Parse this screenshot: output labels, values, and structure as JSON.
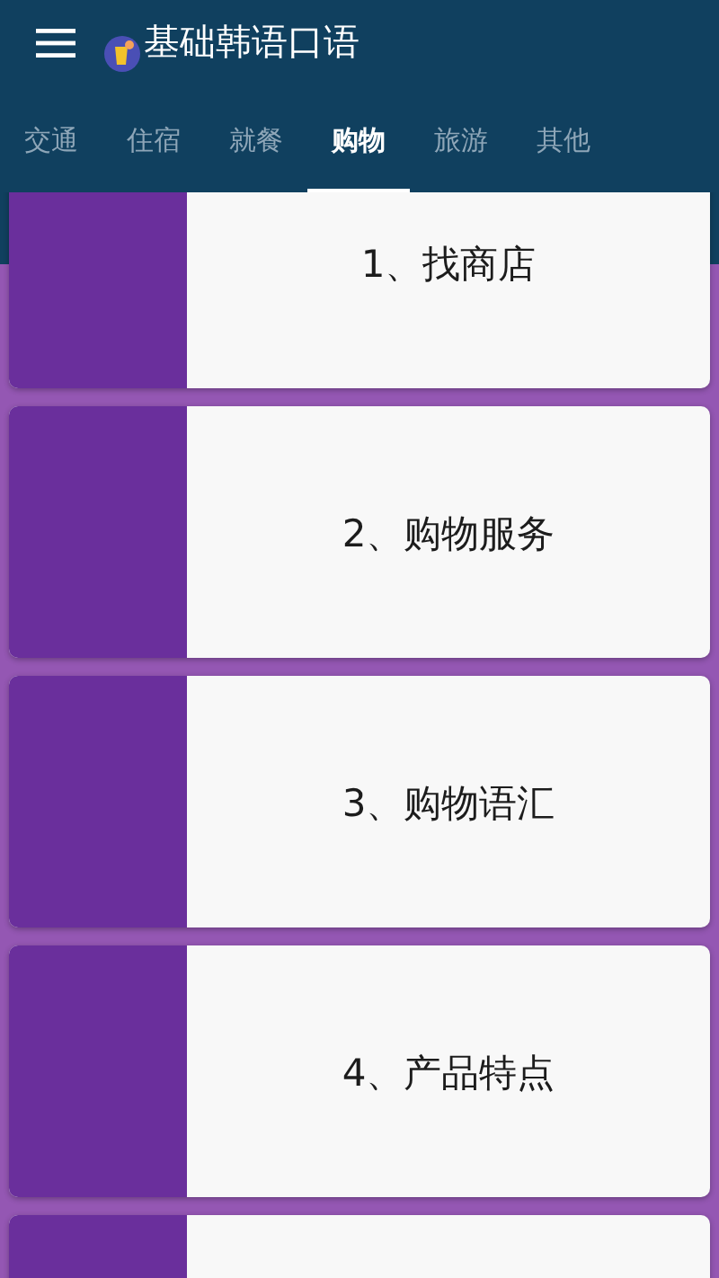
{
  "app_bar": {
    "title": "基础韩语口语"
  },
  "tabs": [
    {
      "label": "交通",
      "selected": false
    },
    {
      "label": "住宿",
      "selected": false
    },
    {
      "label": "就餐",
      "selected": false
    },
    {
      "label": "购物",
      "selected": true
    },
    {
      "label": "旅游",
      "selected": false
    },
    {
      "label": "其他",
      "selected": false
    }
  ],
  "lessons": [
    {
      "title": "1、找商店"
    },
    {
      "title": "2、购物服务"
    },
    {
      "title": "3、购物语汇"
    },
    {
      "title": "4、产品特点"
    }
  ]
}
